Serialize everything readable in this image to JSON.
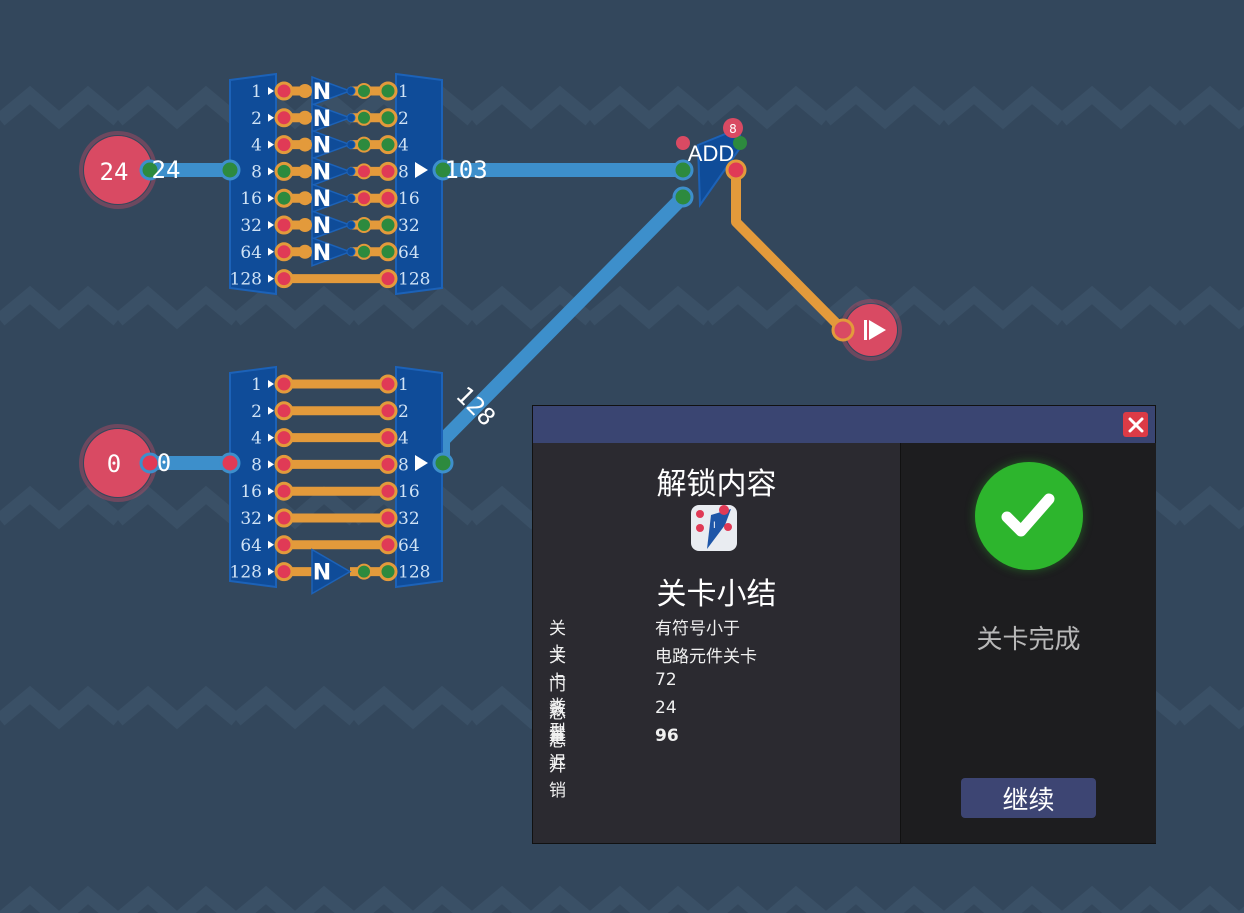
{
  "canvas": {
    "input_a_value": "24",
    "input_a_wire_value": "24",
    "input_b_value": "0",
    "input_b_wire_value": "0",
    "splitter_bits": [
      "1",
      "2",
      "4",
      "8",
      "16",
      "32",
      "64",
      "128"
    ],
    "byte_out_value": "103",
    "wire_128_value": "128",
    "add_label": "ADD",
    "add_badge": "8",
    "output_icon": "play-flag-icon",
    "not_label": "N"
  },
  "colors": {
    "background": "#33475c",
    "wire_blue": "#3d8fcb",
    "wire_orange": "#e39a3b",
    "component_blue": "#0f4c99",
    "pin_red": "#e03a56",
    "pin_green": "#2d8a3e",
    "io_red": "#d94a63",
    "dialog_header": "#3a4572",
    "success_green": "#2db52d"
  },
  "dialog": {
    "close_icon": "close-icon",
    "unlock_title": "解锁内容",
    "unlock_icon": "add-component-icon",
    "summary_title": "关卡小结",
    "rows": [
      {
        "key": "关卡",
        "value": "有符号小于"
      },
      {
        "key": "关卡类型",
        "value": "电路元件关卡"
      },
      {
        "key": "门数量",
        "value": "72"
      },
      {
        "key": "总延迟",
        "value": "24"
      },
      {
        "key": "总开销",
        "value": "96"
      }
    ],
    "status_icon": "checkmark-icon",
    "status_text": "关卡完成",
    "continue_label": "继续"
  }
}
